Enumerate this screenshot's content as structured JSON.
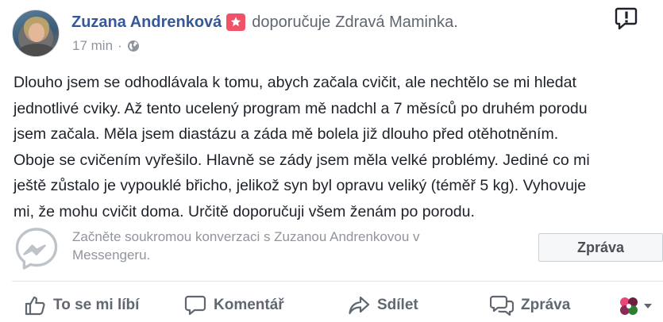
{
  "post": {
    "author": "Zuzana Andrenková",
    "recommends": "doporučuje",
    "page": "Zdravá Maminka.",
    "time": "17 min",
    "separator": "·",
    "text_lines": [
      "Dlouho jsem se odhodlávala k tomu, abych začala cvičit, ale nechtělo se mi hledat",
      "jednotlivé cviky. Až tento ucelený program mě nadchl a 7 měsíců po druhém porodu",
      "jsem začala. Měla jsem diastázu a záda mě bolela již dlouho před otěhotněním.",
      "Oboje se cvičením vyřešilo. Hlavně se zády jsem měla velké problémy. Jediné co mi",
      "ještě zůstalo je vypouklé břicho, jelikož syn byl opravu veliký (téměř 5 kg). Vyhovuje",
      "mi, že mohu cvičit doma. Určitě doporučuji všem ženám po porodu."
    ]
  },
  "messenger": {
    "prompt_line1": "Začněte soukromou konverzaci s Zuzanou Andrenkovou v",
    "prompt_line2": "Messengeru.",
    "button_label": "Zpráva"
  },
  "actions": {
    "like": "To se mi líbí",
    "comment": "Komentář",
    "share": "Sdílet",
    "message": "Zpráva"
  },
  "icons": {
    "avatar": "profile-photo",
    "badge": "recommendation-star-icon",
    "privacy": "globe-icon",
    "report": "report-flag-icon",
    "messenger": "messenger-icon",
    "like": "thumbs-up-icon",
    "comment": "comment-bubble-icon",
    "share": "share-arrow-icon",
    "message": "message-bubble-icon",
    "react": "reactions-menu-icon"
  },
  "colors": {
    "author_link": "#365899",
    "badge": "#f25268",
    "muted": "#90949c",
    "action": "#606770"
  }
}
